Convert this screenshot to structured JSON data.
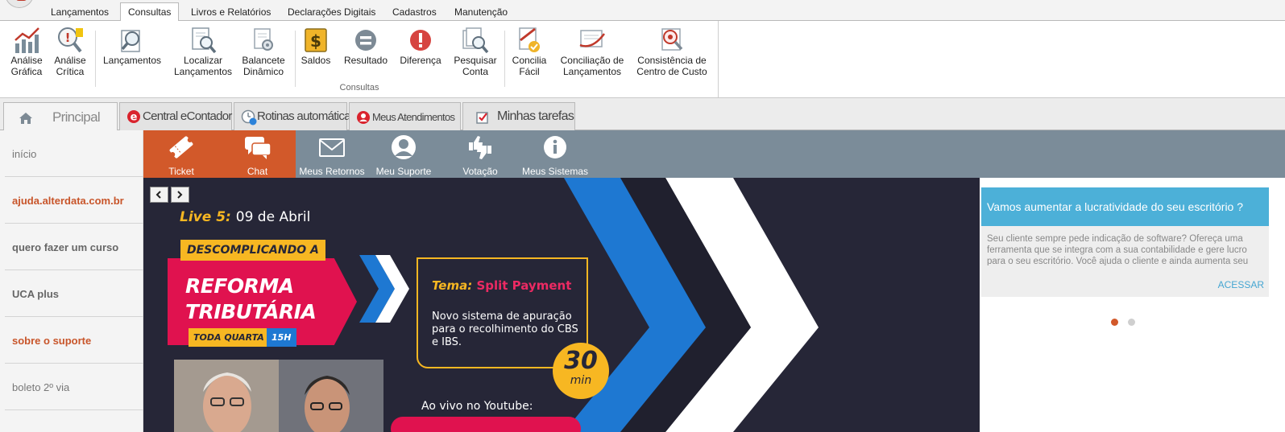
{
  "menu": {
    "tabs": [
      "Lançamentos",
      "Consultas",
      "Livros e Relatórios",
      "Declarações Digitais",
      "Cadastros",
      "Manutenção"
    ],
    "active": "Consultas"
  },
  "ribbon": {
    "group_label": "Consultas",
    "buttons": [
      {
        "line1": "Análise",
        "line2": "Gráfica",
        "icon": "chart-line-icon"
      },
      {
        "line1": "Análise",
        "line2": "Crítica",
        "icon": "alert-magnifier-icon"
      },
      {
        "line1": "Lançamentos",
        "line2": "",
        "icon": "magnifier-doc-icon"
      },
      {
        "line1": "Localizar",
        "line2": "Lançamentos",
        "icon": "doc-search-icon"
      },
      {
        "line1": "Balancete",
        "line2": "Dinâmico",
        "icon": "doc-gear-icon"
      },
      {
        "line1": "Saldos",
        "line2": "",
        "icon": "dollar-icon"
      },
      {
        "line1": "Resultado",
        "line2": "",
        "icon": "equals-icon"
      },
      {
        "line1": "Diferença",
        "line2": "",
        "icon": "exclamation-icon"
      },
      {
        "line1": "Pesquisar",
        "line2": "Conta",
        "icon": "doc-search-icon"
      },
      {
        "line1": "Concilia",
        "line2": "Fácil",
        "icon": "doc-check-icon"
      },
      {
        "line1": "Conciliação de",
        "line2": "Lançamentos",
        "icon": "doc-swoosh-icon"
      },
      {
        "line1": "Consistência de",
        "line2": "Centro de Custo",
        "icon": "doc-magnifier-icon"
      }
    ]
  },
  "pagetabs": [
    {
      "label": "Principal",
      "icon": "home-icon"
    },
    {
      "label": "Central eContador",
      "icon": "e-logo-icon"
    },
    {
      "label": "Rotinas automáticas",
      "icon": "clock-icon"
    },
    {
      "label": "Meus Atendimentos",
      "icon": "support-icon"
    },
    {
      "label": "Minhas tarefas",
      "icon": "checklist-icon"
    }
  ],
  "sidebar": {
    "items": [
      {
        "label": "início"
      },
      {
        "label": "ajuda.alterdata.com.br"
      },
      {
        "label": "quero fazer um curso"
      },
      {
        "label": "UCA plus"
      },
      {
        "label": "sobre o suporte"
      },
      {
        "label": "boleto 2º via"
      }
    ]
  },
  "support_nav": [
    {
      "label": "Ticket",
      "icon": "ticket-icon"
    },
    {
      "label": "Chat",
      "icon": "chat-icon"
    },
    {
      "label": "Meus Retornos",
      "icon": "envelope-icon"
    },
    {
      "label": "Meu Suporte",
      "icon": "user-icon"
    },
    {
      "label": "Votação",
      "icon": "thumbs-icon"
    },
    {
      "label": "Meus Sistemas",
      "icon": "info-icon"
    }
  ],
  "banner": {
    "live_label": "Live 5:",
    "date": "09 de Abril",
    "tag": "DESCOMPLICANDO A",
    "title_line1": "REFORMA",
    "title_line2": "TRIBUTÁRIA",
    "schedule": "TODA QUARTA",
    "hour": "15H",
    "tema_label": "Tema:",
    "tema_value": "Split Payment",
    "description": "Novo sistema de apuração para o recolhimento do CBS e IBS.",
    "duration_number": "30",
    "duration_unit": "min",
    "youtube": "Ao vivo no Youtube:"
  },
  "card": {
    "title": "Vamos aumentar a lucratividade do seu escritório ?",
    "text": "Seu cliente sempre pede indicação de software? Ofereça uma ferramenta que se integra com a sua contabilidade e gere lucro para o seu escritório. Você ajuda o cliente e ainda aumenta seu",
    "link": "ACESSAR"
  },
  "colors": {
    "accent_orange": "#d2592a",
    "nav_gray": "#7b8c99",
    "banner_bg": "#262637",
    "pink": "#e0124f",
    "yellow": "#f7b722",
    "blue": "#1e78d2",
    "card_blue": "#4cb0d8"
  }
}
